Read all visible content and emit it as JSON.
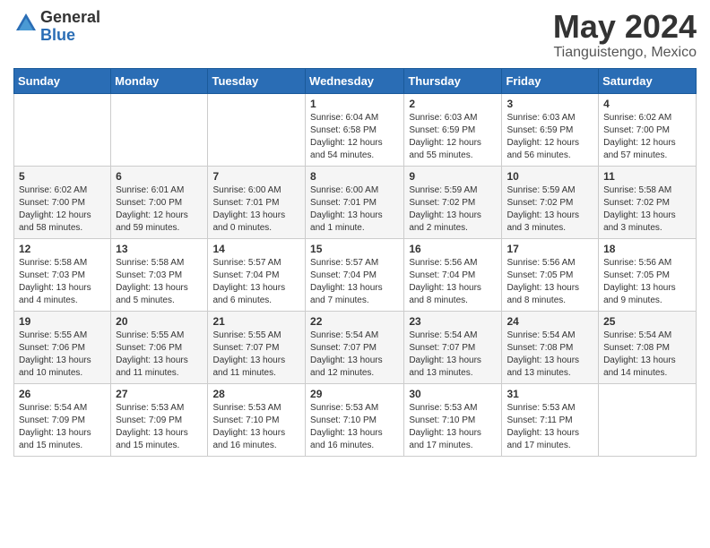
{
  "header": {
    "logo_general": "General",
    "logo_blue": "Blue",
    "main_title": "May 2024",
    "subtitle": "Tianguistengo, Mexico"
  },
  "calendar": {
    "days_of_week": [
      "Sunday",
      "Monday",
      "Tuesday",
      "Wednesday",
      "Thursday",
      "Friday",
      "Saturday"
    ],
    "weeks": [
      [
        {
          "day": "",
          "info": ""
        },
        {
          "day": "",
          "info": ""
        },
        {
          "day": "",
          "info": ""
        },
        {
          "day": "1",
          "info": "Sunrise: 6:04 AM\nSunset: 6:58 PM\nDaylight: 12 hours\nand 54 minutes."
        },
        {
          "day": "2",
          "info": "Sunrise: 6:03 AM\nSunset: 6:59 PM\nDaylight: 12 hours\nand 55 minutes."
        },
        {
          "day": "3",
          "info": "Sunrise: 6:03 AM\nSunset: 6:59 PM\nDaylight: 12 hours\nand 56 minutes."
        },
        {
          "day": "4",
          "info": "Sunrise: 6:02 AM\nSunset: 7:00 PM\nDaylight: 12 hours\nand 57 minutes."
        }
      ],
      [
        {
          "day": "5",
          "info": "Sunrise: 6:02 AM\nSunset: 7:00 PM\nDaylight: 12 hours\nand 58 minutes."
        },
        {
          "day": "6",
          "info": "Sunrise: 6:01 AM\nSunset: 7:00 PM\nDaylight: 12 hours\nand 59 minutes."
        },
        {
          "day": "7",
          "info": "Sunrise: 6:00 AM\nSunset: 7:01 PM\nDaylight: 13 hours\nand 0 minutes."
        },
        {
          "day": "8",
          "info": "Sunrise: 6:00 AM\nSunset: 7:01 PM\nDaylight: 13 hours\nand 1 minute."
        },
        {
          "day": "9",
          "info": "Sunrise: 5:59 AM\nSunset: 7:02 PM\nDaylight: 13 hours\nand 2 minutes."
        },
        {
          "day": "10",
          "info": "Sunrise: 5:59 AM\nSunset: 7:02 PM\nDaylight: 13 hours\nand 3 minutes."
        },
        {
          "day": "11",
          "info": "Sunrise: 5:58 AM\nSunset: 7:02 PM\nDaylight: 13 hours\nand 3 minutes."
        }
      ],
      [
        {
          "day": "12",
          "info": "Sunrise: 5:58 AM\nSunset: 7:03 PM\nDaylight: 13 hours\nand 4 minutes."
        },
        {
          "day": "13",
          "info": "Sunrise: 5:58 AM\nSunset: 7:03 PM\nDaylight: 13 hours\nand 5 minutes."
        },
        {
          "day": "14",
          "info": "Sunrise: 5:57 AM\nSunset: 7:04 PM\nDaylight: 13 hours\nand 6 minutes."
        },
        {
          "day": "15",
          "info": "Sunrise: 5:57 AM\nSunset: 7:04 PM\nDaylight: 13 hours\nand 7 minutes."
        },
        {
          "day": "16",
          "info": "Sunrise: 5:56 AM\nSunset: 7:04 PM\nDaylight: 13 hours\nand 8 minutes."
        },
        {
          "day": "17",
          "info": "Sunrise: 5:56 AM\nSunset: 7:05 PM\nDaylight: 13 hours\nand 8 minutes."
        },
        {
          "day": "18",
          "info": "Sunrise: 5:56 AM\nSunset: 7:05 PM\nDaylight: 13 hours\nand 9 minutes."
        }
      ],
      [
        {
          "day": "19",
          "info": "Sunrise: 5:55 AM\nSunset: 7:06 PM\nDaylight: 13 hours\nand 10 minutes."
        },
        {
          "day": "20",
          "info": "Sunrise: 5:55 AM\nSunset: 7:06 PM\nDaylight: 13 hours\nand 11 minutes."
        },
        {
          "day": "21",
          "info": "Sunrise: 5:55 AM\nSunset: 7:07 PM\nDaylight: 13 hours\nand 11 minutes."
        },
        {
          "day": "22",
          "info": "Sunrise: 5:54 AM\nSunset: 7:07 PM\nDaylight: 13 hours\nand 12 minutes."
        },
        {
          "day": "23",
          "info": "Sunrise: 5:54 AM\nSunset: 7:07 PM\nDaylight: 13 hours\nand 13 minutes."
        },
        {
          "day": "24",
          "info": "Sunrise: 5:54 AM\nSunset: 7:08 PM\nDaylight: 13 hours\nand 13 minutes."
        },
        {
          "day": "25",
          "info": "Sunrise: 5:54 AM\nSunset: 7:08 PM\nDaylight: 13 hours\nand 14 minutes."
        }
      ],
      [
        {
          "day": "26",
          "info": "Sunrise: 5:54 AM\nSunset: 7:09 PM\nDaylight: 13 hours\nand 15 minutes."
        },
        {
          "day": "27",
          "info": "Sunrise: 5:53 AM\nSunset: 7:09 PM\nDaylight: 13 hours\nand 15 minutes."
        },
        {
          "day": "28",
          "info": "Sunrise: 5:53 AM\nSunset: 7:10 PM\nDaylight: 13 hours\nand 16 minutes."
        },
        {
          "day": "29",
          "info": "Sunrise: 5:53 AM\nSunset: 7:10 PM\nDaylight: 13 hours\nand 16 minutes."
        },
        {
          "day": "30",
          "info": "Sunrise: 5:53 AM\nSunset: 7:10 PM\nDaylight: 13 hours\nand 17 minutes."
        },
        {
          "day": "31",
          "info": "Sunrise: 5:53 AM\nSunset: 7:11 PM\nDaylight: 13 hours\nand 17 minutes."
        },
        {
          "day": "",
          "info": ""
        }
      ]
    ]
  }
}
